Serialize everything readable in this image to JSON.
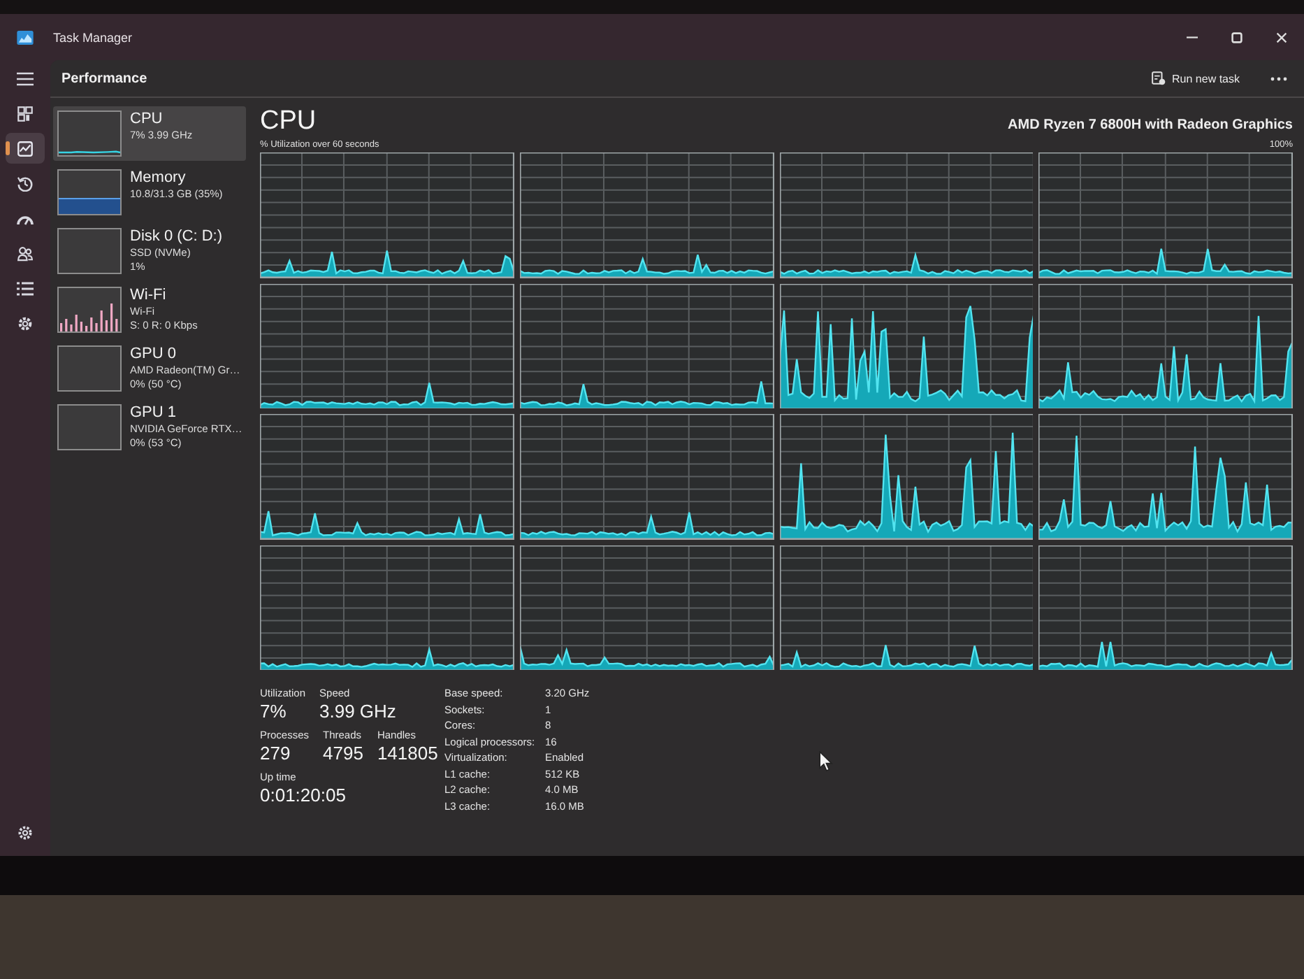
{
  "window": {
    "title": "Task Manager"
  },
  "nav": [
    {
      "kind": "menu",
      "selected": false
    },
    {
      "kind": "processes",
      "selected": false
    },
    {
      "kind": "performance",
      "selected": true
    },
    {
      "kind": "history",
      "selected": false
    },
    {
      "kind": "startup",
      "selected": false
    },
    {
      "kind": "users",
      "selected": false
    },
    {
      "kind": "details",
      "selected": false
    },
    {
      "kind": "services",
      "selected": false
    },
    {
      "kind": "settings",
      "selected": false
    }
  ],
  "header": {
    "title": "Performance",
    "run_task": "Run new task"
  },
  "devices": [
    {
      "name": "CPU",
      "lines": [
        "7% 3.99 GHz"
      ],
      "kind": "line",
      "selected": true
    },
    {
      "name": "Memory",
      "lines": [
        "10.8/31.3 GB (35%)"
      ],
      "kind": "fill",
      "selected": false
    },
    {
      "name": "Disk 0 (C: D:)",
      "lines": [
        "SSD (NVMe)",
        "1%"
      ],
      "kind": "empty",
      "selected": false
    },
    {
      "name": "Wi-Fi",
      "lines": [
        "Wi-Fi",
        "S: 0 R: 0 Kbps"
      ],
      "kind": "bars",
      "selected": false
    },
    {
      "name": "GPU 0",
      "lines": [
        "AMD Radeon(TM) Gr…",
        "0% (50 °C)"
      ],
      "kind": "empty",
      "selected": false
    },
    {
      "name": "GPU 1",
      "lines": [
        "NVIDIA GeForce RTX…",
        "0% (53 °C)"
      ],
      "kind": "empty",
      "selected": false
    }
  ],
  "cpu": {
    "title": "CPU",
    "model": "AMD Ryzen 7 6800H with Radeon Graphics",
    "graph_caption": "% Utilization over 60 seconds",
    "graph_max": "100%",
    "graphs": [
      {
        "kind": "idle"
      },
      {
        "kind": "idle"
      },
      {
        "kind": "idle"
      },
      {
        "kind": "idle"
      },
      {
        "kind": "idle"
      },
      {
        "kind": "idle"
      },
      {
        "kind": "busy"
      },
      {
        "kind": "busy"
      },
      {
        "kind": "idle"
      },
      {
        "kind": "idle"
      },
      {
        "kind": "busy"
      },
      {
        "kind": "busy"
      },
      {
        "kind": "idle"
      },
      {
        "kind": "idle"
      },
      {
        "kind": "idle"
      },
      {
        "kind": "idle"
      }
    ],
    "stats": [
      [
        {
          "label": "Utilization",
          "value": "7%"
        },
        {
          "label": "Speed",
          "value": "3.99 GHz"
        }
      ],
      [
        {
          "label": "Processes",
          "value": "279"
        },
        {
          "label": "Threads",
          "value": "4795"
        },
        {
          "label": "Handles",
          "value": "141805"
        }
      ],
      [
        {
          "label": "Up time",
          "value": "0:01:20:05"
        }
      ]
    ],
    "specs": [
      {
        "label": "Base speed:",
        "value": "3.20 GHz"
      },
      {
        "label": "Sockets:",
        "value": "1"
      },
      {
        "label": "Cores:",
        "value": "8"
      },
      {
        "label": "Logical processors:",
        "value": "16"
      },
      {
        "label": "Virtualization:",
        "value": "Enabled"
      },
      {
        "label": "L1 cache:",
        "value": "512 KB"
      },
      {
        "label": "L2 cache:",
        "value": "4.0 MB"
      },
      {
        "label": "L3 cache:",
        "value": "16.0 MB"
      }
    ]
  }
}
